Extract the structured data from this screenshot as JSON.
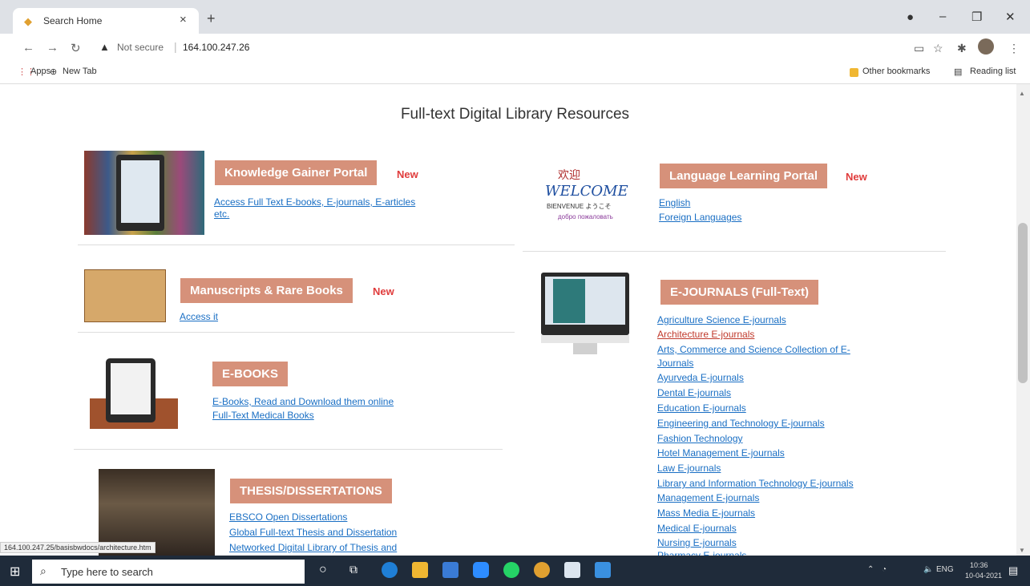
{
  "browser": {
    "tab_title": "Search Home",
    "tab_close": "×",
    "new_tab": "+",
    "not_secure": "Not secure",
    "url": "164.100.247.26",
    "apps_label": "Apps",
    "new_tab_bookmark": "New Tab",
    "other_bookmarks": "Other bookmarks",
    "reading_list": "Reading list",
    "status_url": "164.100.247.25/basisbwdocs/architecture.htm"
  },
  "page": {
    "heading": "Full-text Digital Library Resources",
    "new_label": "New",
    "left": [
      {
        "title": "Knowledge Gainer Portal",
        "new": true,
        "links": [
          "Access Full Text E-books, E-journals, E-articles",
          "etc."
        ]
      },
      {
        "title": "Manuscripts & Rare Books",
        "new": true,
        "links": [
          "Access it"
        ]
      },
      {
        "title": "E-BOOKS",
        "new": false,
        "links": [
          "E-Books, Read and Download them online",
          "Full-Text Medical Books"
        ]
      },
      {
        "title": "THESIS/DISSERTATIONS",
        "new": false,
        "links": [
          "EBSCO Open Dissertations",
          "Global Full-text Thesis and Dissertation",
          "Networked Digital Library of Thesis and"
        ]
      }
    ],
    "right": [
      {
        "title": "Language Learning Portal",
        "new": true,
        "links": [
          "English",
          "Foreign Languages"
        ]
      },
      {
        "title": "E-JOURNALS (Full-Text)",
        "new": false,
        "links": [
          "Agriculture Science E-journals",
          "Architecture E-journals",
          "Arts, Commerce and Science Collection of E-",
          "Journals",
          "Ayurveda E-journals",
          "Dental E-journals",
          "Education E-journals",
          "Engineering and Technology E-journals",
          "Fashion Technology",
          "Hotel Management E-journals",
          "Law E-journals",
          "Library and Information Technology E-journals",
          "Management E-journals",
          "Mass Media E-journals",
          "Medical E-journals",
          "Nursing E-journals",
          "Pharmacy E-journals"
        ]
      }
    ],
    "welcome_image_text": "WELCOME"
  },
  "taskbar": {
    "search_placeholder": "Type here to search",
    "lang": "ENG",
    "time": "10:36",
    "date": "10-04-2021"
  },
  "colors": {
    "badge": "#d6917a",
    "new": "#e03c3c",
    "link": "#1a6fc4",
    "visited": "#c0392b"
  }
}
